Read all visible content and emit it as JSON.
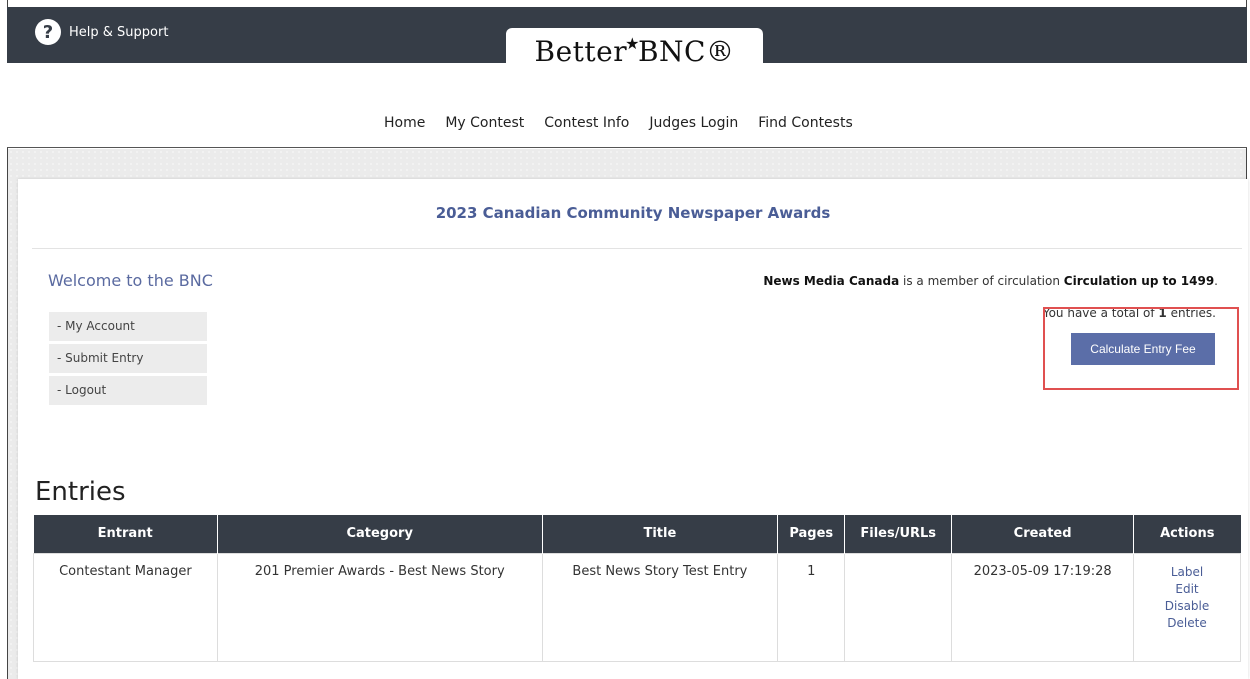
{
  "header": {
    "help_label": "Help & Support",
    "logo_left": "Better",
    "logo_right": "BNC®"
  },
  "nav": {
    "items": [
      "Home",
      "My Contest",
      "Contest Info",
      "Judges Login",
      "Find Contests"
    ]
  },
  "contest_title": "2023 Canadian Community Newspaper Awards",
  "welcome": "Welcome to the BNC",
  "side_menu": [
    "- My Account",
    "- Submit Entry",
    "- Logout"
  ],
  "member": {
    "org": "News Media Canada",
    "mid": " is a member of circulation ",
    "circ": "Circulation up to 1499",
    "end": "."
  },
  "totals": {
    "pre": "You have a total of ",
    "count": "1",
    "post": " entries."
  },
  "calc_button": "Calculate Entry Fee",
  "entries": {
    "heading": "Entries",
    "columns": [
      "Entrant",
      "Category",
      "Title",
      "Pages",
      "Files/URLs",
      "Created",
      "Actions"
    ],
    "rows": [
      {
        "entrant": "Contestant Manager",
        "category": "201 Premier Awards - Best News Story",
        "title": "Best News Story Test Entry",
        "pages": "1",
        "files": "",
        "created": "2023-05-09 17:19:28",
        "actions": [
          "Label",
          "Edit",
          "Disable",
          "Delete"
        ]
      }
    ]
  },
  "colors": {
    "header_dark": "#363d47",
    "accent": "#5b6ea8",
    "link": "#4a5d96",
    "highlight": "#e05050"
  }
}
